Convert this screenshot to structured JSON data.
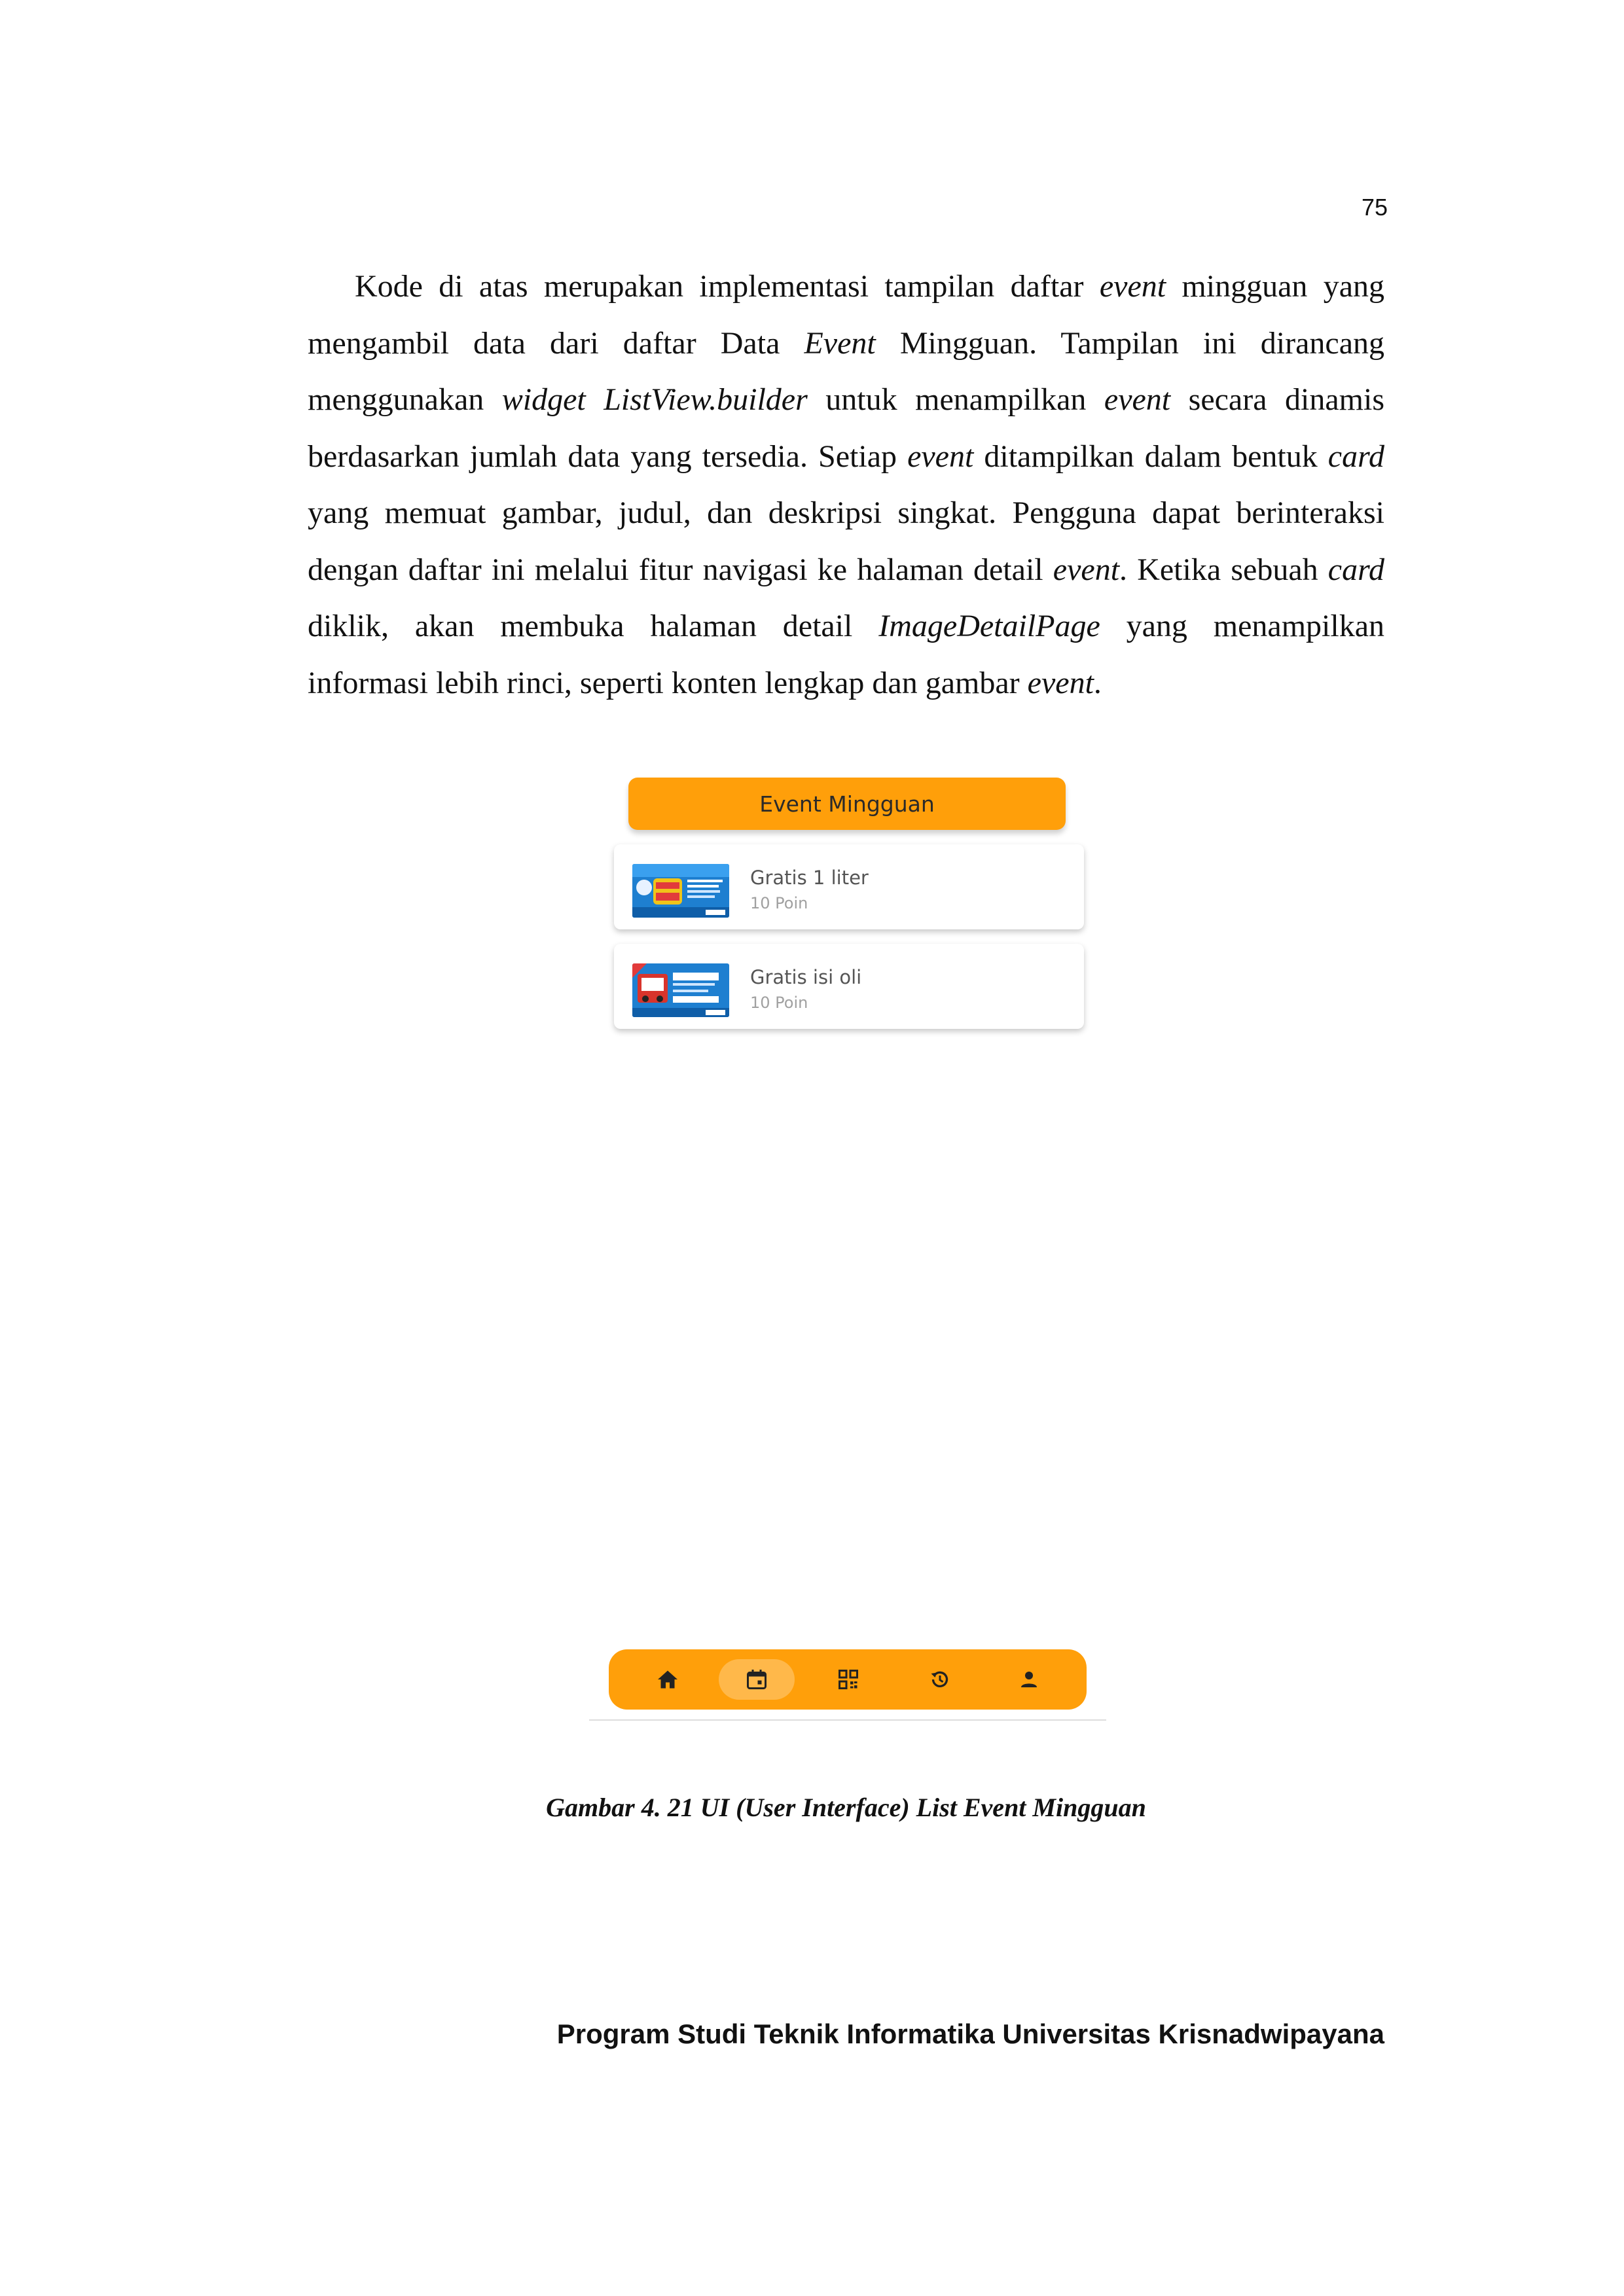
{
  "page": {
    "number": "75",
    "paragraph": [
      {
        "text": "Kode di atas merupakan implementasi tampilan daftar ",
        "italic": false
      },
      {
        "text": "event",
        "italic": true
      },
      {
        "text": " mingguan yang mengambil data dari daftar Data ",
        "italic": false
      },
      {
        "text": "Event",
        "italic": true
      },
      {
        "text": " Mingguan. Tampilan ini dirancang menggunakan ",
        "italic": false
      },
      {
        "text": "widget ListView.builder",
        "italic": true
      },
      {
        "text": " untuk menampilkan ",
        "italic": false
      },
      {
        "text": "event",
        "italic": true
      },
      {
        "text": " secara dinamis berdasarkan jumlah data yang tersedia. Setiap ",
        "italic": false
      },
      {
        "text": "event",
        "italic": true
      },
      {
        "text": " ditampilkan dalam bentuk ",
        "italic": false
      },
      {
        "text": "card",
        "italic": true
      },
      {
        "text": " yang memuat gambar, judul, dan deskripsi singkat. Pengguna dapat berinteraksi dengan daftar ini melalui fitur navigasi ke halaman detail ",
        "italic": false
      },
      {
        "text": "event",
        "italic": true
      },
      {
        "text": ". Ketika sebuah ",
        "italic": false
      },
      {
        "text": "card",
        "italic": true
      },
      {
        "text": " diklik, akan membuka halaman detail ",
        "italic": false
      },
      {
        "text": "ImageDetailPage",
        "italic": true
      },
      {
        "text": " yang menampilkan informasi lebih rinci, seperti konten lengkap dan gambar ",
        "italic": false
      },
      {
        "text": "event",
        "italic": true
      },
      {
        "text": ".",
        "italic": false
      }
    ],
    "caption": "Gambar 4. 21 UI (User Interface) List Event Mingguan",
    "footer": "Program Studi Teknik Informatika Universitas Krisnadwipayana"
  },
  "app": {
    "header_title": "Event Mingguan",
    "events": [
      {
        "title": "Gratis 1 liter",
        "points": "10 Poin"
      },
      {
        "title": "Gratis isi oli",
        "points": "10 Poin"
      }
    ],
    "nav_items": [
      {
        "icon": "home-icon",
        "active": false
      },
      {
        "icon": "calendar-icon",
        "active": true
      },
      {
        "icon": "qr-code-icon",
        "active": false
      },
      {
        "icon": "history-icon",
        "active": false
      },
      {
        "icon": "profile-icon",
        "active": false
      }
    ],
    "colors": {
      "accent": "#ff9f0a",
      "active_pill": "#ffb84a",
      "thumb_blue": "#1e7fd0"
    }
  }
}
